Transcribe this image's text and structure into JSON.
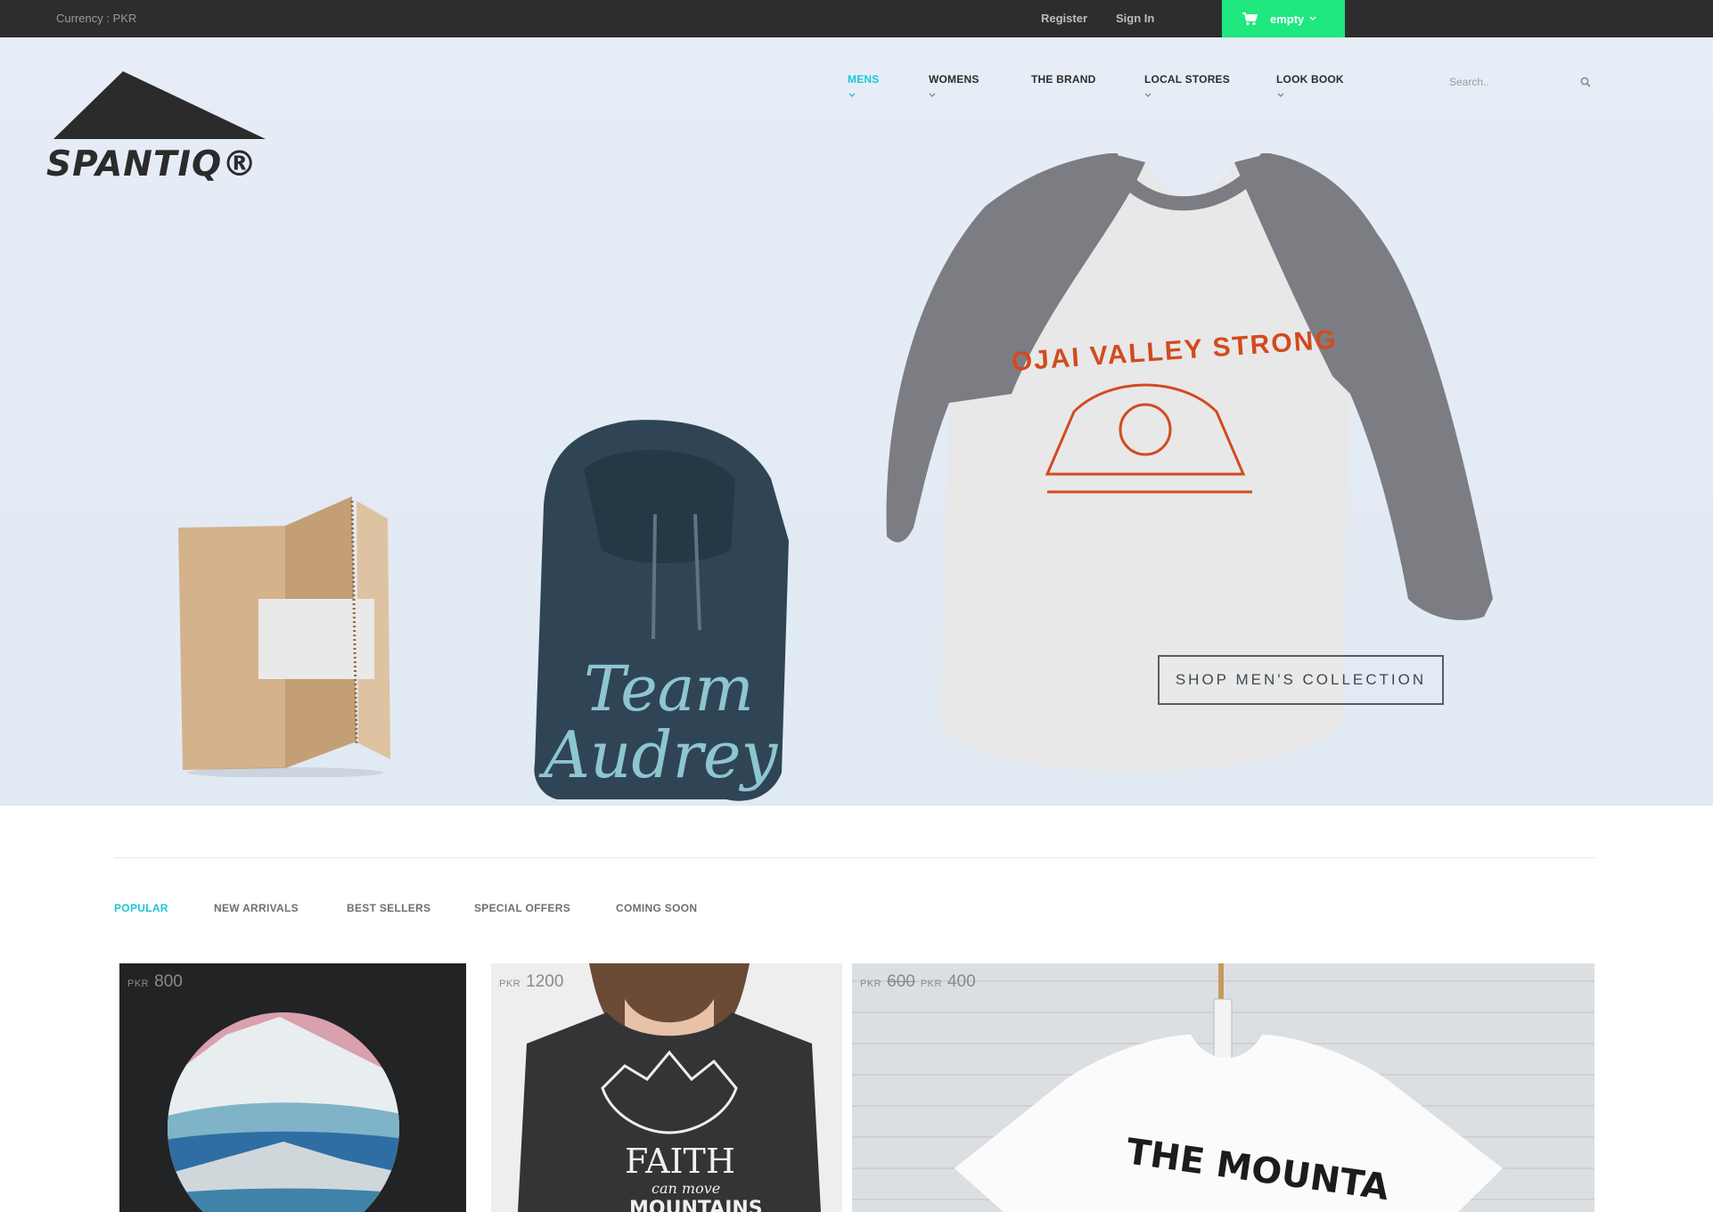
{
  "topbar": {
    "currency": "Currency : PKR",
    "register": "Register",
    "sign_in": "Sign In",
    "cart_label": "empty",
    "cart_color": "#1ee87e"
  },
  "brand": {
    "name": "SPANTIQ®"
  },
  "nav": {
    "items": [
      {
        "label": "MENS",
        "active": true,
        "has_dropdown": true
      },
      {
        "label": "WOMENS",
        "active": false,
        "has_dropdown": true
      },
      {
        "label": "THE BRAND",
        "active": false,
        "has_dropdown": false
      },
      {
        "label": "LOCAL STORES",
        "active": false,
        "has_dropdown": true
      },
      {
        "label": "LOOK BOOK",
        "active": false,
        "has_dropdown": true
      }
    ],
    "accent_color": "#1cc6d8"
  },
  "search": {
    "placeholder": "Search.."
  },
  "hero": {
    "cta": "SHOP MEN'S COLLECTION",
    "tee_print": "OJAI VALLEY STRONG",
    "hoodie_print_line1": "Team",
    "hoodie_print_line2": "Audrey"
  },
  "tabs": [
    {
      "label": "POPULAR",
      "active": true
    },
    {
      "label": "NEW ARRIVALS",
      "active": false
    },
    {
      "label": "BEST SELLERS",
      "active": false
    },
    {
      "label": "SPECIAL OFFERS",
      "active": false
    },
    {
      "label": "COMING SOON",
      "active": false
    }
  ],
  "products": [
    {
      "currency": "PKR",
      "price": "800"
    },
    {
      "currency": "PKR",
      "price": "1200",
      "print_line1": "FAITH",
      "print_line2": "can move",
      "print_line3": "MOUNTAINS"
    },
    {
      "currency": "PKR",
      "old_price": "600",
      "currency2": "PKR",
      "price": "400",
      "print": "THE MOUNTA"
    }
  ]
}
